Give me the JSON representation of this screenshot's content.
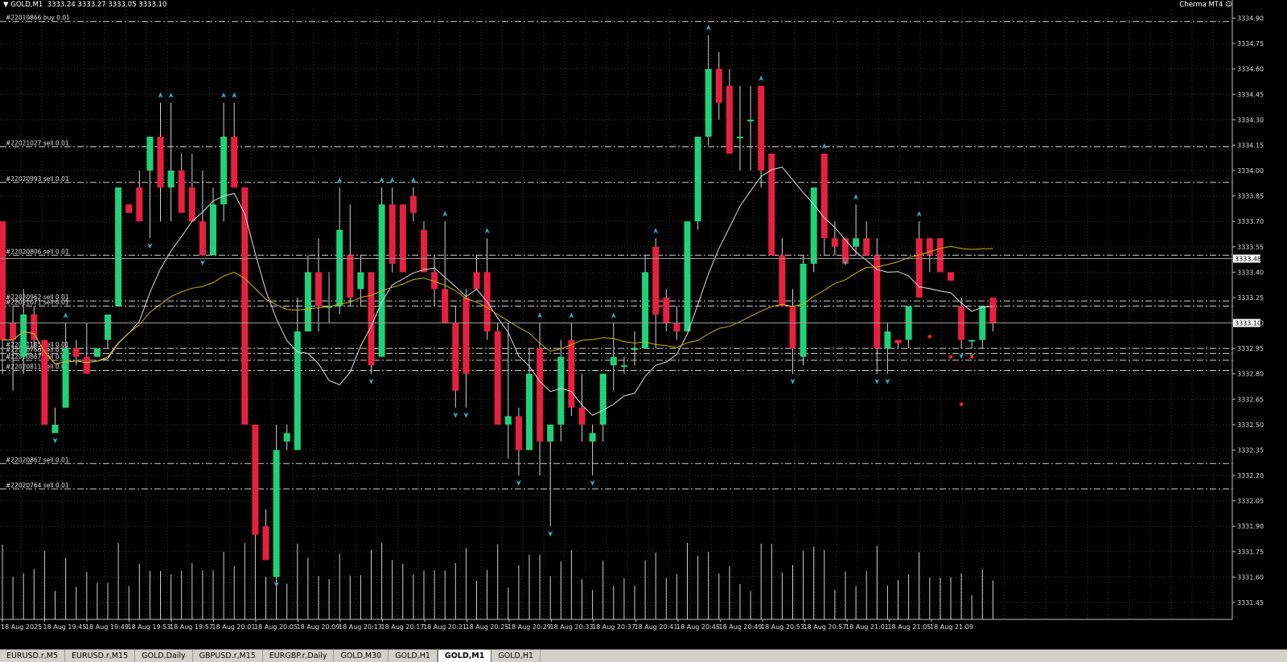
{
  "header": {
    "symbol": "GOLD,M1",
    "ohlc": "3333.24 3333.27 3333.05 3333.10",
    "brand": "Cherma MT4"
  },
  "colors": {
    "bull": "#1fd27a",
    "bear": "#e8203f",
    "ma_fast": "#dddddd",
    "ma_slow": "#c8b400",
    "grid": "#3a3a3a",
    "arrow": "#2bb3c8",
    "marker": "#ff2020"
  },
  "price_axis": {
    "min": 3331.35,
    "max": 3334.95,
    "labels": [
      "3334.90",
      "3334.75",
      "3334.60",
      "3334.45",
      "3334.30",
      "3334.15",
      "3334.00",
      "3333.85",
      "3333.70",
      "3333.55",
      "3333.40",
      "3333.25",
      "3333.10",
      "3332.95",
      "3332.80",
      "3332.65",
      "3332.50",
      "3332.35",
      "3332.20",
      "3332.05",
      "3331.90",
      "3331.75",
      "3331.60",
      "3331.45"
    ],
    "ask_label": "3333.48",
    "bid_label": "3333.10"
  },
  "time_axis": {
    "labels": [
      "18 Aug 2025",
      "18 Aug 19:45",
      "18 Aug 19:49",
      "18 Aug 19:53",
      "18 Aug 19:57",
      "18 Aug 20:01",
      "18 Aug 20:05",
      "18 Aug 20:09",
      "18 Aug 20:13",
      "18 Aug 20:17",
      "18 Aug 20:21",
      "18 Aug 20:25",
      "18 Aug 20:29",
      "18 Aug 20:33",
      "18 Aug 20:37",
      "18 Aug 20:41",
      "18 Aug 20:45",
      "18 Aug 20:49",
      "18 Aug 20:53",
      "18 Aug 20:57",
      "18 Aug 21:01",
      "18 Aug 21:05",
      "18 Aug 21:09"
    ]
  },
  "order_lines": [
    {
      "label": "#22019866 buy 0.01",
      "price": 3334.88
    },
    {
      "label": "#22021027 sell 0.01",
      "price": 3334.14
    },
    {
      "label": "#22020993 sell 0.01",
      "price": 3333.93
    },
    {
      "label": "#22020806 sell 0.01",
      "price": 3333.5
    },
    {
      "label": "#22020962 sell 0.01",
      "price": 3333.23
    },
    {
      "label": "#22021071 sell 0.01",
      "price": 3333.2
    },
    {
      "label": "#22021185 sell 0.01",
      "price": 3332.95
    },
    {
      "label": "#22020766 sell 0.01",
      "price": 3332.92
    },
    {
      "label": "#22020867 sell 0.01",
      "price": 3332.88
    },
    {
      "label": "#22020811 sell 0.01",
      "price": 3332.82
    },
    {
      "label": "#22020867 sell 0.01",
      "price": 3332.27
    },
    {
      "label": "#22020764 sell 0.01",
      "price": 3332.12
    }
  ],
  "candles": [
    [
      3333.7,
      3333.7,
      3332.8,
      3333.0
    ],
    [
      3333.1,
      3333.2,
      3332.7,
      3333.0
    ],
    [
      3332.9,
      3333.3,
      3332.8,
      3333.15
    ],
    [
      3333.15,
      3333.2,
      3332.95,
      3333.0
    ],
    [
      3333.0,
      3333.0,
      3332.5,
      3332.5
    ],
    [
      3332.45,
      3332.6,
      3332.45,
      3332.5
    ],
    [
      3332.6,
      3333.1,
      3332.6,
      3332.95
    ],
    [
      3332.95,
      3333.0,
      3332.85,
      3332.9
    ],
    [
      3332.9,
      3333.1,
      3332.9,
      3332.8
    ],
    [
      3332.9,
      3332.95,
      3332.9,
      3332.95
    ],
    [
      3333.0,
      3333.15,
      3332.95,
      3333.15
    ],
    [
      3333.2,
      3333.9,
      3333.2,
      3333.9
    ],
    [
      3333.8,
      3333.8,
      3333.75,
      3333.75
    ],
    [
      3333.9,
      3334.0,
      3333.7,
      3333.7
    ],
    [
      3334.0,
      3334.2,
      3333.6,
      3334.2
    ],
    [
      3334.2,
      3334.4,
      3333.7,
      3333.9
    ],
    [
      3333.9,
      3334.4,
      3333.7,
      3334.0
    ],
    [
      3334.0,
      3334.1,
      3333.8,
      3333.75
    ],
    [
      3333.9,
      3334.1,
      3333.7,
      3333.7
    ],
    [
      3333.7,
      3334.0,
      3333.5,
      3333.5
    ],
    [
      3333.5,
      3333.9,
      3333.7,
      3333.8
    ],
    [
      3333.8,
      3334.4,
      3333.7,
      3334.2
    ],
    [
      3334.2,
      3334.4,
      3333.9,
      3333.9
    ],
    [
      3333.9,
      3333.9,
      3332.7,
      3332.5
    ],
    [
      3332.5,
      3332.5,
      3331.8,
      3331.85
    ],
    [
      3331.9,
      3332.0,
      3331.7,
      3331.7
    ],
    [
      3331.6,
      3332.5,
      3331.6,
      3332.35
    ],
    [
      3332.4,
      3332.5,
      3332.35,
      3332.45
    ],
    [
      3332.35,
      3333.25,
      3332.35,
      3333.05
    ],
    [
      3333.05,
      3333.5,
      3333.05,
      3333.4
    ],
    [
      3333.4,
      3333.6,
      3333.05,
      3333.2
    ],
    [
      3333.2,
      3333.4,
      3333.1,
      3333.2
    ],
    [
      3333.2,
      3333.9,
      3333.15,
      3333.65
    ],
    [
      3333.5,
      3333.8,
      3333.2,
      3333.25
    ],
    [
      3333.3,
      3333.5,
      3333.2,
      3333.4
    ],
    [
      3333.4,
      3333.4,
      3332.8,
      3332.85
    ],
    [
      3332.9,
      3333.9,
      3332.9,
      3333.8
    ],
    [
      3333.8,
      3333.9,
      3333.4,
      3333.45
    ],
    [
      3333.8,
      3333.8,
      3333.4,
      3333.4
    ],
    [
      3333.85,
      3333.9,
      3333.7,
      3333.75
    ],
    [
      3333.65,
      3333.7,
      3333.4,
      3333.4
    ],
    [
      3333.4,
      3333.5,
      3333.2,
      3333.3
    ],
    [
      3333.3,
      3333.7,
      3333.2,
      3333.1
    ],
    [
      3333.1,
      3333.2,
      3332.6,
      3332.7
    ],
    [
      3333.25,
      3333.3,
      3332.6,
      3332.8
    ],
    [
      3333.4,
      3333.5,
      3333.3,
      3333.3
    ],
    [
      3333.4,
      3333.6,
      3333.0,
      3333.05
    ],
    [
      3333.05,
      3333.1,
      3332.5,
      3332.5
    ],
    [
      3332.5,
      3333.1,
      3332.3,
      3332.55
    ],
    [
      3332.55,
      3332.6,
      3332.2,
      3332.35
    ],
    [
      3332.35,
      3332.95,
      3332.35,
      3332.8
    ],
    [
      3332.95,
      3333.1,
      3332.2,
      3332.4
    ],
    [
      3332.4,
      3332.5,
      3331.9,
      3332.5
    ],
    [
      3332.5,
      3333.0,
      3332.4,
      3332.9
    ],
    [
      3333.0,
      3333.1,
      3332.55,
      3332.6
    ],
    [
      3332.6,
      3332.8,
      3332.4,
      3332.5
    ],
    [
      3332.4,
      3332.5,
      3332.2,
      3332.45
    ],
    [
      3332.5,
      3332.8,
      3332.4,
      3332.8
    ],
    [
      3332.85,
      3333.1,
      3332.7,
      3332.9
    ],
    [
      3332.85,
      3332.9,
      3332.8,
      3332.85
    ],
    [
      3332.95,
      3333.05,
      3332.85,
      3332.95
    ],
    [
      3332.95,
      3333.5,
      3332.95,
      3333.4
    ],
    [
      3333.55,
      3333.6,
      3332.95,
      3333.15
    ],
    [
      3333.25,
      3333.3,
      3333.05,
      3333.1
    ],
    [
      3333.1,
      3333.2,
      3333.0,
      3333.05
    ],
    [
      3333.05,
      3333.7,
      3333.05,
      3333.7
    ],
    [
      3333.7,
      3334.1,
      3333.65,
      3334.2
    ],
    [
      3334.2,
      3334.8,
      3334.15,
      3334.6
    ],
    [
      3334.6,
      3334.7,
      3334.3,
      3334.4
    ],
    [
      3334.5,
      3334.6,
      3334.2,
      3334.1
    ],
    [
      3334.2,
      3334.5,
      3334.0,
      3334.2
    ],
    [
      3334.3,
      3334.5,
      3334.0,
      3334.3
    ],
    [
      3334.5,
      3334.5,
      3333.9,
      3334.0
    ],
    [
      3334.1,
      3334.1,
      3333.5,
      3333.5
    ],
    [
      3333.5,
      3333.6,
      3333.2,
      3333.2
    ],
    [
      3333.2,
      3333.3,
      3332.8,
      3332.95
    ],
    [
      3332.9,
      3333.5,
      3332.85,
      3333.45
    ],
    [
      3333.45,
      3333.9,
      3333.4,
      3333.9
    ],
    [
      3334.1,
      3334.1,
      3333.5,
      3333.6
    ],
    [
      3333.6,
      3333.7,
      3333.5,
      3333.55
    ],
    [
      3333.6,
      3333.6,
      3333.5,
      3333.45
    ],
    [
      3333.55,
      3333.8,
      3333.5,
      3333.6
    ],
    [
      3333.6,
      3333.7,
      3333.5,
      3333.5
    ],
    [
      3333.5,
      3333.6,
      3332.8,
      3332.95
    ],
    [
      3332.95,
      3333.1,
      3332.8,
      3333.05
    ],
    [
      3333.0,
      3333.0,
      3332.95,
      3332.98
    ],
    [
      3333.0,
      3333.2,
      3332.95,
      3333.2
    ],
    [
      3333.6,
      3333.7,
      3333.25,
      3333.25
    ],
    [
      3333.6,
      3333.6,
      3333.4,
      3333.5
    ],
    [
      3333.6,
      3333.6,
      3333.4,
      3333.4
    ],
    [
      3333.4,
      3333.4,
      3333.35,
      3333.35
    ],
    [
      3333.2,
      3333.25,
      3332.95,
      3333.0
    ],
    [
      3333.0,
      3333.0,
      3332.95,
      3333.0
    ],
    [
      3333.0,
      3333.2,
      3332.95,
      3333.2
    ],
    [
      3333.25,
      3333.25,
      3333.05,
      3333.1
    ]
  ],
  "tabs": [
    {
      "label": "EURUSD.r,M5",
      "active": false
    },
    {
      "label": "EURUSD.r,M15",
      "active": false
    },
    {
      "label": "GOLD,Daily",
      "active": false
    },
    {
      "label": "GBPUSD.r,M15",
      "active": false
    },
    {
      "label": "EURGBP.r,Daily",
      "active": false
    },
    {
      "label": "GOLD,M30",
      "active": false
    },
    {
      "label": "GOLD,H1",
      "active": false
    },
    {
      "label": "GOLD,M1",
      "active": true
    },
    {
      "label": "GOLD,H1",
      "active": false
    }
  ]
}
